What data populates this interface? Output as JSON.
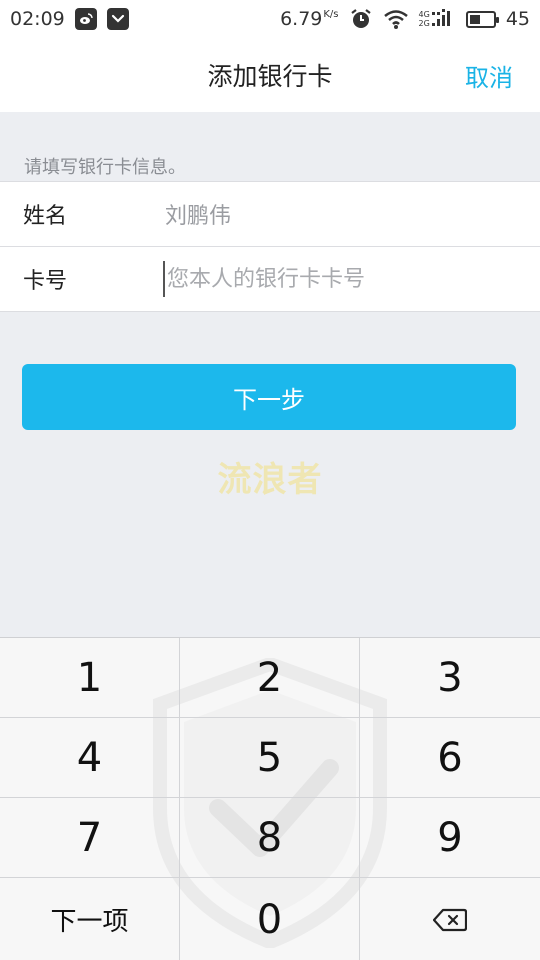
{
  "status_bar": {
    "time": "02:09",
    "left_icons": [
      "weibo-icon",
      "pocket-icon"
    ],
    "network_speed": "6.79",
    "network_unit": "K/s",
    "network_type_top": "4G",
    "network_type_bottom": "2G",
    "battery_level": "45",
    "battery_fraction": 0.45
  },
  "header": {
    "title": "添加银行卡",
    "cancel_label": "取消"
  },
  "form": {
    "hint": "请填写银行卡信息。",
    "name_label": "姓名",
    "name_value": "刘鹏伟",
    "card_label": "卡号",
    "card_placeholder": "您本人的银行卡卡号",
    "card_value": ""
  },
  "next_button_label": "下一步",
  "watermark_text": "流浪者",
  "keypad": {
    "keys": [
      "1",
      "2",
      "3",
      "4",
      "5",
      "6",
      "7",
      "8",
      "9",
      "下一项",
      "0"
    ],
    "backspace_icon": "backspace-icon"
  },
  "colors": {
    "accent": "#1ab3e6",
    "button": "#1cb8ec",
    "background": "#eceef2",
    "watermark": "#efe6b3"
  }
}
